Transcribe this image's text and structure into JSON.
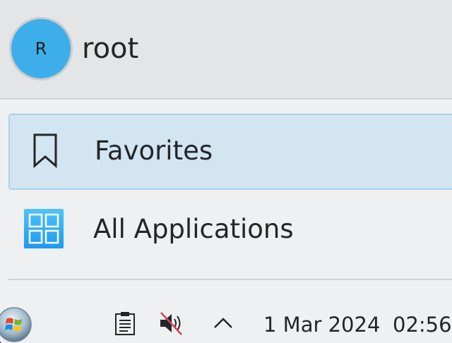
{
  "user": {
    "avatar_initial": "R",
    "name": "root"
  },
  "nav": [
    {
      "label": "Favorites",
      "icon": "bookmark-icon",
      "selected": true
    },
    {
      "label": "All Applications",
      "icon": "applications-grid-icon",
      "selected": false
    }
  ],
  "taskbar": {
    "tray_icons": [
      "clipboard-icon",
      "volume-muted-icon",
      "chevron-up-icon"
    ],
    "date": "1 Mar 2024",
    "time": "02:56"
  },
  "colors": {
    "accent": "#3daee9",
    "selection": "#d3e5f0",
    "selection_border": "#a7d3ec"
  }
}
